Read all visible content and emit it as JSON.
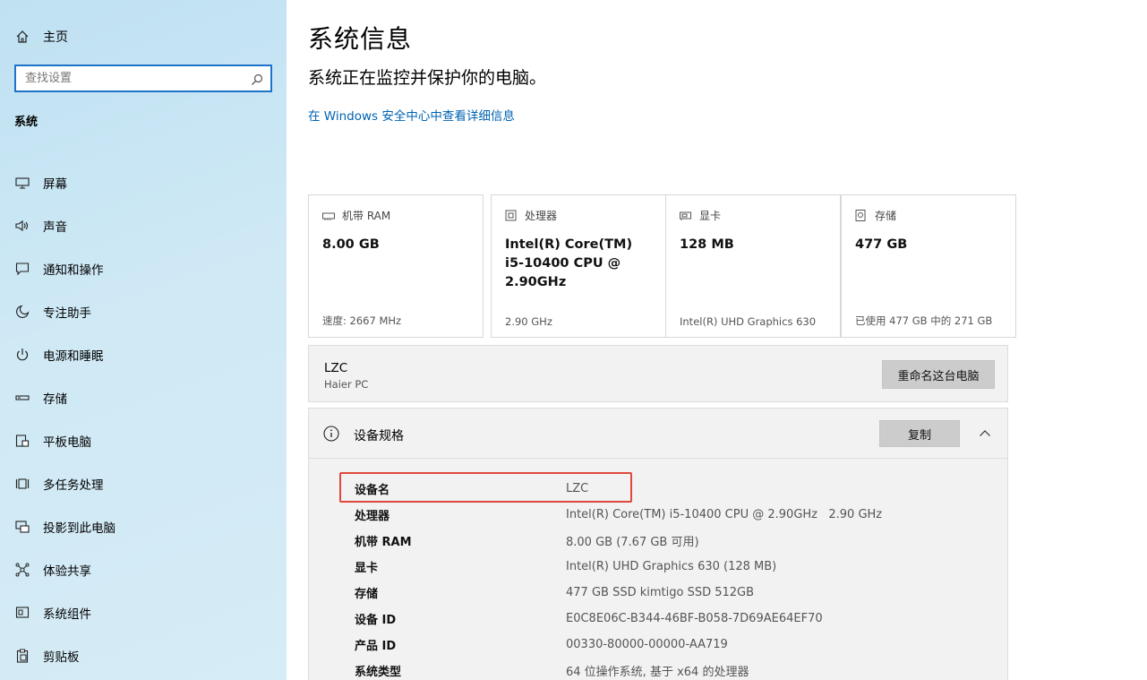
{
  "sidebar": {
    "home_label": "主页",
    "search_placeholder": "查找设置",
    "section_label": "系统",
    "items": [
      {
        "label": "屏幕"
      },
      {
        "label": "声音"
      },
      {
        "label": "通知和操作"
      },
      {
        "label": "专注助手"
      },
      {
        "label": "电源和睡眠"
      },
      {
        "label": "存储"
      },
      {
        "label": "平板电脑"
      },
      {
        "label": "多任务处理"
      },
      {
        "label": "投影到此电脑"
      },
      {
        "label": "体验共享"
      },
      {
        "label": "系统组件"
      },
      {
        "label": "剪贴板"
      }
    ]
  },
  "main": {
    "title": "系统信息",
    "subtitle": "系统正在监控并保护你的电脑。",
    "security_link": "在 Windows 安全中心中查看详细信息",
    "cards": [
      {
        "label": "机带 RAM",
        "value": "8.00 GB",
        "foot": "速度: 2667 MHz"
      },
      {
        "label": "处理器",
        "value": "Intel(R) Core(TM) i5-10400 CPU @ 2.90GHz",
        "foot": "2.90 GHz"
      },
      {
        "label": "显卡",
        "value": "128 MB",
        "foot": "Intel(R) UHD Graphics 630"
      },
      {
        "label": "存储",
        "value": "477 GB",
        "foot": "已使用 477 GB 中的 271 GB"
      }
    ],
    "pc": {
      "name": "LZC",
      "model": "Haier PC",
      "rename_label": "重命名这台电脑"
    },
    "specs": {
      "title": "设备规格",
      "copy_label": "复制",
      "rows": [
        {
          "label": "设备名",
          "value": "LZC"
        },
        {
          "label": "处理器",
          "value": "Intel(R) Core(TM) i5-10400 CPU @ 2.90GHz   2.90 GHz"
        },
        {
          "label": "机带 RAM",
          "value": "8.00 GB (7.67 GB 可用)"
        },
        {
          "label": "显卡",
          "value": "Intel(R) UHD Graphics 630 (128 MB)"
        },
        {
          "label": "存储",
          "value": "477 GB SSD kimtigo SSD 512GB"
        },
        {
          "label": "设备 ID",
          "value": "E0C8E06C-B344-46BF-B058-7D69AE64EF70"
        },
        {
          "label": "产品 ID",
          "value": "00330-80000-00000-AA719"
        },
        {
          "label": "系统类型",
          "value": "64 位操作系统, 基于 x64 的处理器"
        }
      ]
    }
  },
  "colors": {
    "accent": "#1e73c8",
    "link": "#0063b1",
    "highlight": "#e0483b"
  }
}
